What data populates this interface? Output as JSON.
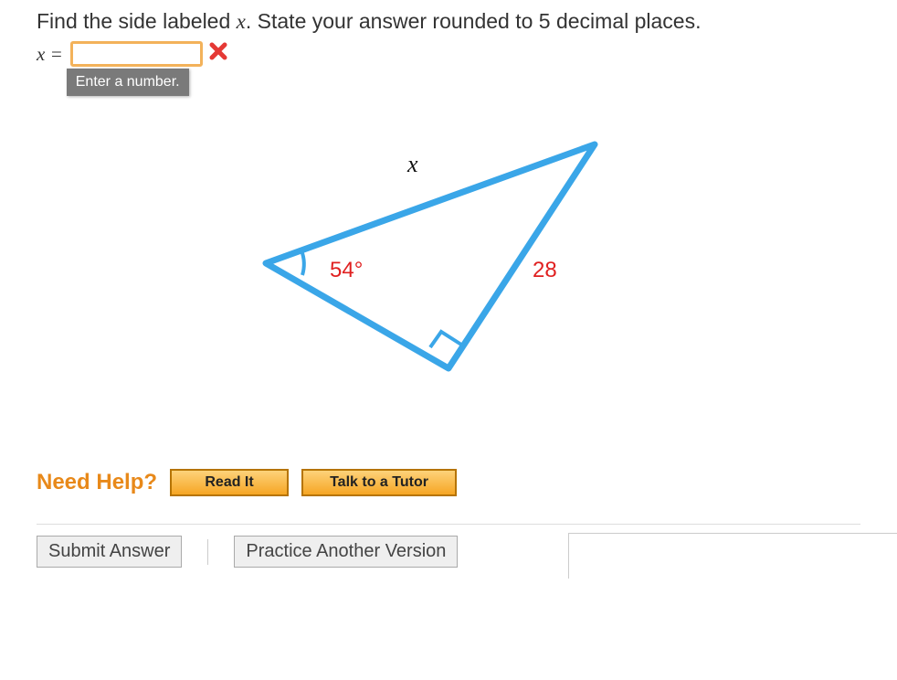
{
  "question": {
    "prefix": "Find the side labeled ",
    "var": "x",
    "suffix": ". State your answer rounded to 5 decimal places."
  },
  "answer": {
    "var_label": "x =",
    "value": "",
    "tooltip": "Enter a number.",
    "status": "wrong"
  },
  "diagram": {
    "side_label": "x",
    "angle": "54°",
    "known_side": "28"
  },
  "help": {
    "label": "Need Help?",
    "read_it": "Read It",
    "talk_tutor": "Talk to a Tutor"
  },
  "actions": {
    "submit": "Submit Answer",
    "practice": "Practice Another Version"
  }
}
